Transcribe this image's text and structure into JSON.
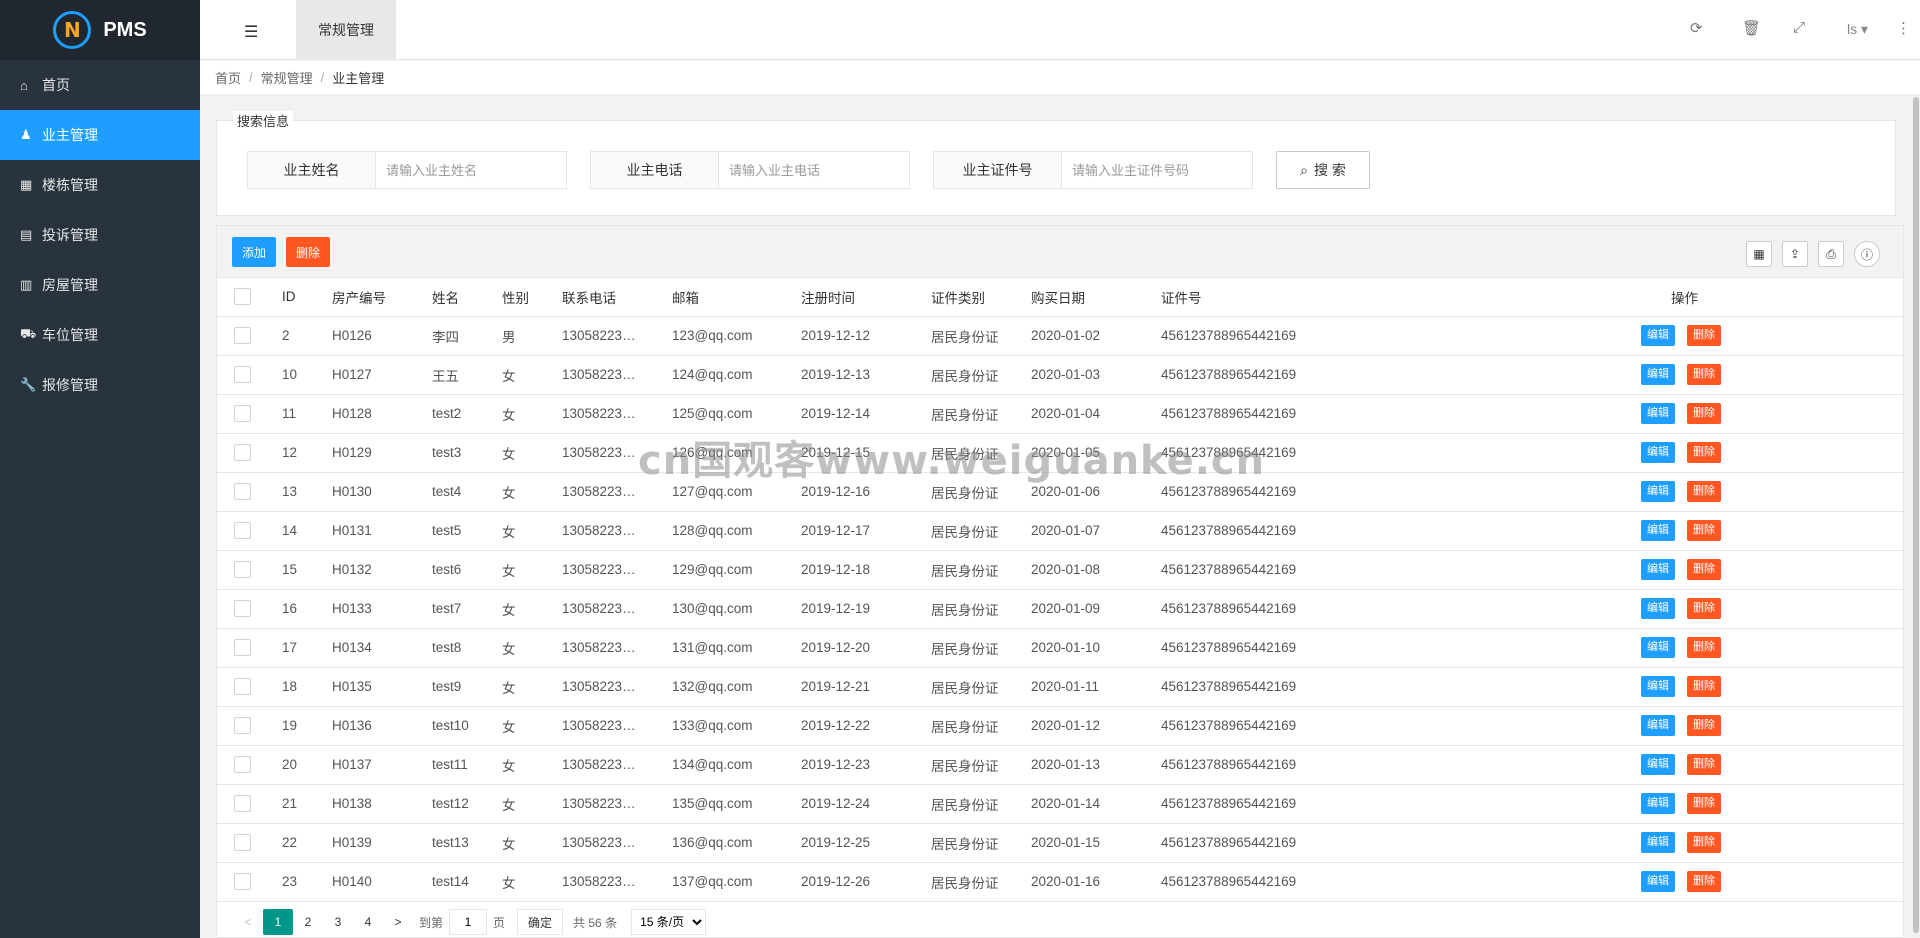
{
  "app": {
    "name": "PMS"
  },
  "sidebar": {
    "items": [
      {
        "label": "首页",
        "icon": "home-icon",
        "glyph": "⌂",
        "active": false
      },
      {
        "label": "业主管理",
        "icon": "person-icon",
        "glyph": "♟",
        "active": true
      },
      {
        "label": "楼栋管理",
        "icon": "building-icon",
        "glyph": "▦",
        "active": false
      },
      {
        "label": "投诉管理",
        "icon": "document-icon",
        "glyph": "▤",
        "active": false
      },
      {
        "label": "房屋管理",
        "icon": "house-icon",
        "glyph": "▥",
        "active": false
      },
      {
        "label": "车位管理",
        "icon": "car-icon",
        "glyph": "⛟",
        "active": false
      },
      {
        "label": "报修管理",
        "icon": "wrench-icon",
        "glyph": "🔧",
        "active": false
      }
    ]
  },
  "header": {
    "tab": "常规管理",
    "user": "ls ▾"
  },
  "breadcrumb": {
    "home": "首页",
    "section": "常规管理",
    "current": "业主管理"
  },
  "search": {
    "legend": "搜索信息",
    "fields": [
      {
        "label": "业主姓名",
        "placeholder": "请输入业主姓名"
      },
      {
        "label": "业主电话",
        "placeholder": "请输入业主电话"
      },
      {
        "label": "业主证件号",
        "placeholder": "请输入业主证件号码"
      }
    ],
    "button": "搜 索"
  },
  "toolbar": {
    "add": "添加",
    "delete": "删除"
  },
  "table": {
    "columns": [
      "ID",
      "房产编号",
      "姓名",
      "性别",
      "联系电话",
      "邮箱",
      "注册时间",
      "证件类别",
      "购买日期",
      "证件号",
      "操作"
    ],
    "edit_label": "编辑",
    "delete_label": "删除",
    "rows": [
      [
        "2",
        "H0126",
        "李四",
        "男",
        "13058223…",
        "123@qq.com",
        "2019-12-12",
        "居民身份证",
        "2020-01-02",
        "456123788965442169"
      ],
      [
        "10",
        "H0127",
        "王五",
        "女",
        "13058223…",
        "124@qq.com",
        "2019-12-13",
        "居民身份证",
        "2020-01-03",
        "456123788965442169"
      ],
      [
        "11",
        "H0128",
        "test2",
        "女",
        "13058223…",
        "125@qq.com",
        "2019-12-14",
        "居民身份证",
        "2020-01-04",
        "456123788965442169"
      ],
      [
        "12",
        "H0129",
        "test3",
        "女",
        "13058223…",
        "126@qq.com",
        "2019-12-15",
        "居民身份证",
        "2020-01-05",
        "456123788965442169"
      ],
      [
        "13",
        "H0130",
        "test4",
        "女",
        "13058223…",
        "127@qq.com",
        "2019-12-16",
        "居民身份证",
        "2020-01-06",
        "456123788965442169"
      ],
      [
        "14",
        "H0131",
        "test5",
        "女",
        "13058223…",
        "128@qq.com",
        "2019-12-17",
        "居民身份证",
        "2020-01-07",
        "456123788965442169"
      ],
      [
        "15",
        "H0132",
        "test6",
        "女",
        "13058223…",
        "129@qq.com",
        "2019-12-18",
        "居民身份证",
        "2020-01-08",
        "456123788965442169"
      ],
      [
        "16",
        "H0133",
        "test7",
        "女",
        "13058223…",
        "130@qq.com",
        "2019-12-19",
        "居民身份证",
        "2020-01-09",
        "456123788965442169"
      ],
      [
        "17",
        "H0134",
        "test8",
        "女",
        "13058223…",
        "131@qq.com",
        "2019-12-20",
        "居民身份证",
        "2020-01-10",
        "456123788965442169"
      ],
      [
        "18",
        "H0135",
        "test9",
        "女",
        "13058223…",
        "132@qq.com",
        "2019-12-21",
        "居民身份证",
        "2020-01-11",
        "456123788965442169"
      ],
      [
        "19",
        "H0136",
        "test10",
        "女",
        "13058223…",
        "133@qq.com",
        "2019-12-22",
        "居民身份证",
        "2020-01-12",
        "456123788965442169"
      ],
      [
        "20",
        "H0137",
        "test11",
        "女",
        "13058223…",
        "134@qq.com",
        "2019-12-23",
        "居民身份证",
        "2020-01-13",
        "456123788965442169"
      ],
      [
        "21",
        "H0138",
        "test12",
        "女",
        "13058223…",
        "135@qq.com",
        "2019-12-24",
        "居民身份证",
        "2020-01-14",
        "456123788965442169"
      ],
      [
        "22",
        "H0139",
        "test13",
        "女",
        "13058223…",
        "136@qq.com",
        "2019-12-25",
        "居民身份证",
        "2020-01-15",
        "456123788965442169"
      ],
      [
        "23",
        "H0140",
        "test14",
        "女",
        "13058223…",
        "137@qq.com",
        "2019-12-26",
        "居民身份证",
        "2020-01-16",
        "456123788965442169"
      ]
    ]
  },
  "pager": {
    "pages": [
      "1",
      "2",
      "3",
      "4"
    ],
    "current": "1",
    "goto_label": "到第",
    "goto_value": "1",
    "page_unit": "页",
    "confirm": "确定",
    "total": "共 56 条",
    "per_page": "15 条/页"
  },
  "watermark": "cn国观客www.weiguanke.cn",
  "colors": {
    "sidebar": "#28333e",
    "accent": "#1e9fff",
    "danger": "#ff5722",
    "pager": "#009688"
  }
}
